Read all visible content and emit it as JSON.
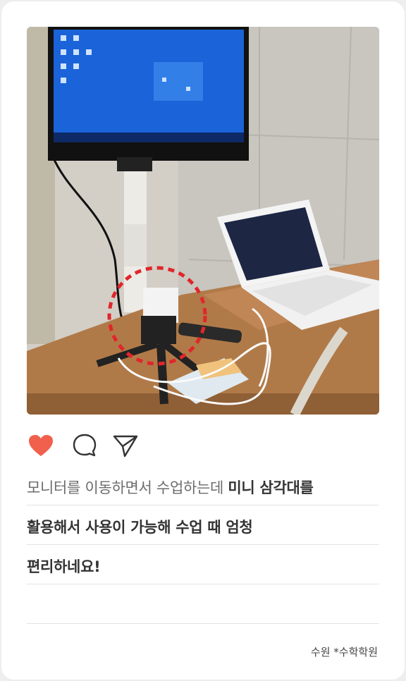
{
  "post": {
    "caption_lines": [
      {
        "part1": "모니터를 이동하면서 수업하는데 ",
        "part2": "미니 삼각대를"
      },
      {
        "text": "활용해서 사용이 가능해 수업 때 엄청"
      },
      {
        "text": "편리하네요!"
      }
    ],
    "author": "수원 *수학학원",
    "liked": true
  },
  "icons": {
    "like": "heart-icon",
    "comment": "comment-bubble-icon",
    "share": "paper-plane-icon"
  },
  "colors": {
    "heart": "#f0604d",
    "highlight_circle": "#e0262a",
    "monitor_screen": "#1a63d8"
  }
}
